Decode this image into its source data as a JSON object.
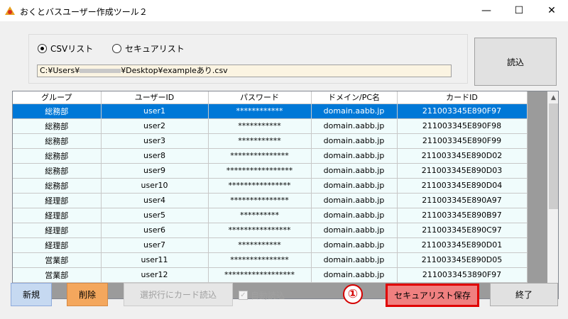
{
  "window": {
    "title": "おくとバスユーザー作成ツール２",
    "minimize": "—",
    "maximize": "☐",
    "close": "✕"
  },
  "source": {
    "options": [
      {
        "label": "CSVリスト",
        "selected": true
      },
      {
        "label": "セキュアリスト",
        "selected": false
      }
    ],
    "path_prefix": "C:¥Users¥",
    "path_suffix": "¥Desktop¥exampleあり.csv",
    "read_button": "読込"
  },
  "grid": {
    "columns": [
      "グループ",
      "ユーザーID",
      "パスワード",
      "ドメイン/PC名",
      "カードID"
    ],
    "rows": [
      [
        "総務部",
        "user1",
        "************",
        "domain.aabb.jp",
        "211003345E890F97"
      ],
      [
        "総務部",
        "user2",
        "***********",
        "domain.aabb.jp",
        "211003345E890F98"
      ],
      [
        "総務部",
        "user3",
        "***********",
        "domain.aabb.jp",
        "211003345E890F99"
      ],
      [
        "総務部",
        "user8",
        "***************",
        "domain.aabb.jp",
        "211003345E890D02"
      ],
      [
        "総務部",
        "user9",
        "*****************",
        "domain.aabb.jp",
        "211003345E890D03"
      ],
      [
        "総務部",
        "user10",
        "****************",
        "domain.aabb.jp",
        "211003345E890D04"
      ],
      [
        "経理部",
        "user4",
        "***************",
        "domain.aabb.jp",
        "211003345E890A97"
      ],
      [
        "経理部",
        "user5",
        "**********",
        "domain.aabb.jp",
        "211003345E890B97"
      ],
      [
        "経理部",
        "user6",
        "****************",
        "domain.aabb.jp",
        "211003345E890C97"
      ],
      [
        "経理部",
        "user7",
        "***********",
        "domain.aabb.jp",
        "211003345E890D01"
      ],
      [
        "営業部",
        "user11",
        "***************",
        "domain.aabb.jp",
        "211003345E890D05"
      ],
      [
        "営業部",
        "user12",
        "******************",
        "domain.aabb.jp",
        "2110033453890F97"
      ]
    ],
    "selected_row": 0
  },
  "actions": {
    "new": "新規",
    "delete": "削除",
    "read_card": "選択行にカード読込",
    "auto_read": "自動読込",
    "auto_read_checked": true,
    "marker": "①",
    "save_secure": "セキュアリスト保存",
    "exit": "終了"
  }
}
